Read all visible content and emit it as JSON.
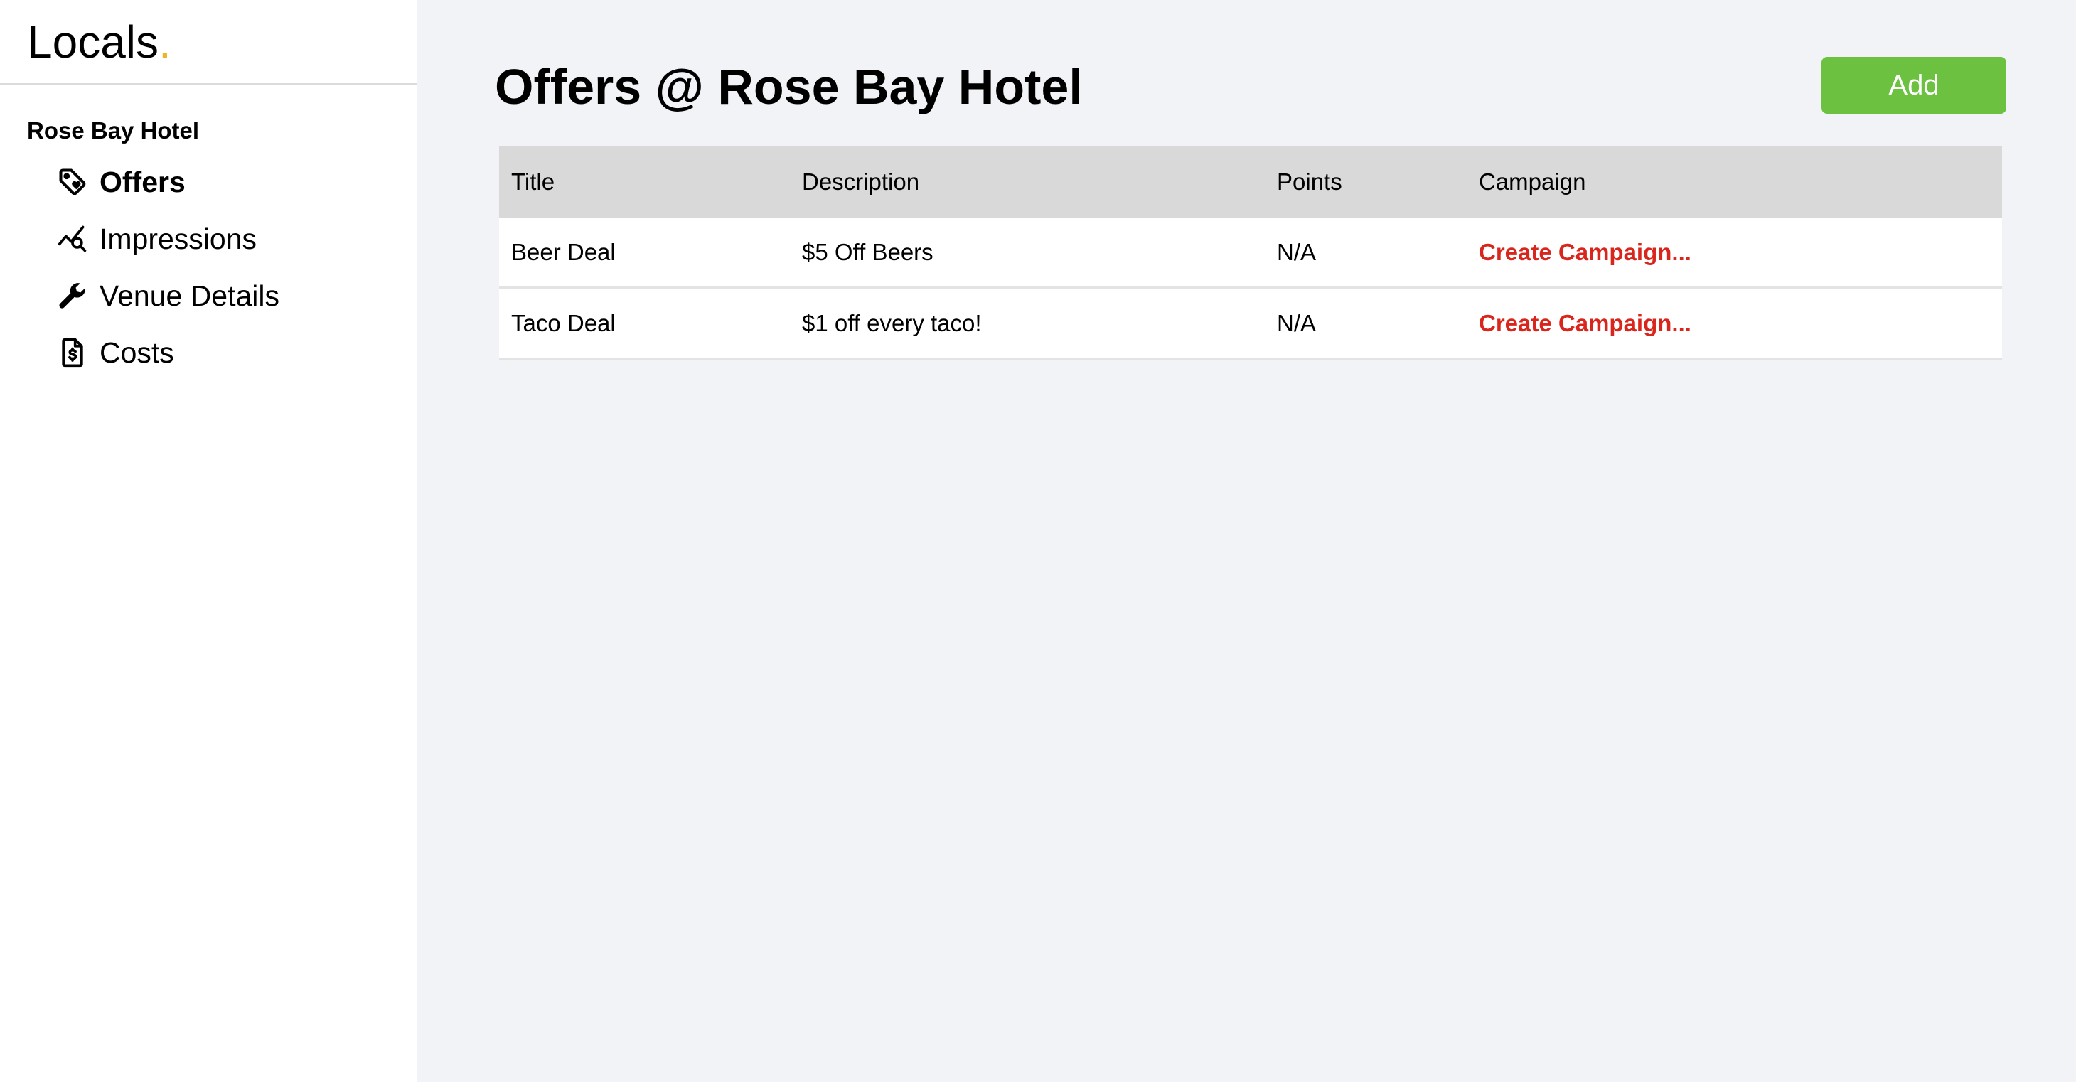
{
  "brand": {
    "name": "Locals",
    "dot": ".",
    "dot_color": "#f0b323"
  },
  "sidebar": {
    "venue": "Rose Bay Hotel",
    "items": [
      {
        "label": "Offers",
        "icon": "tag-icon",
        "active": true
      },
      {
        "label": "Impressions",
        "icon": "chart-search-icon",
        "active": false
      },
      {
        "label": "Venue Details",
        "icon": "wrench-icon",
        "active": false
      },
      {
        "label": "Costs",
        "icon": "invoice-dollar-icon",
        "active": false
      }
    ]
  },
  "main": {
    "title": "Offers @ Rose Bay Hotel",
    "add_label": "Add",
    "add_color": "#6cc140",
    "table": {
      "headers": [
        "Title",
        "Description",
        "Points",
        "Campaign"
      ],
      "rows": [
        {
          "title": "Beer Deal",
          "description": "$5 Off Beers",
          "points": "N/A",
          "campaign": "Create Campaign..."
        },
        {
          "title": "Taco Deal",
          "description": "$1 off every taco!",
          "points": "N/A",
          "campaign": "Create Campaign..."
        }
      ]
    },
    "link_color": "#d9261c"
  }
}
